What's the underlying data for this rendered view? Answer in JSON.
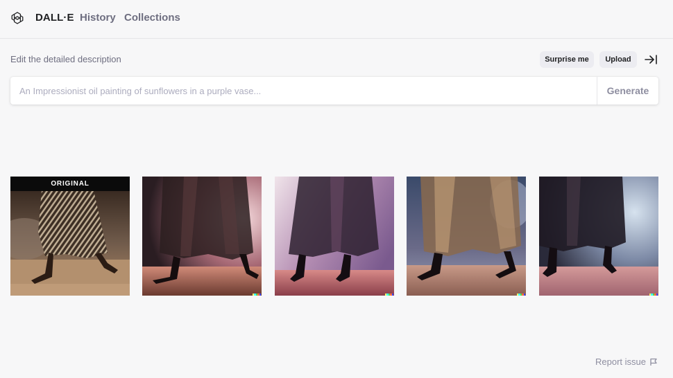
{
  "header": {
    "brand": "DALL·E",
    "nav": [
      "History",
      "Collections"
    ]
  },
  "editor": {
    "label": "Edit the detailed description",
    "surprise_label": "Surprise me",
    "upload_label": "Upload",
    "prompt_placeholder": "An Impressionist oil painting of sunflowers in a purple vase...",
    "prompt_value": "",
    "generate_label": "Generate"
  },
  "gallery": {
    "original_label": "ORIGINAL",
    "tiles": [
      {
        "kind": "original",
        "description": "dancer legs in high heels, sheer patterned skirt, dusty floor"
      },
      {
        "kind": "variation",
        "description": "dancer legs in heels, sheer dark skirt, pink smoke"
      },
      {
        "kind": "variation",
        "description": "dancer legs in heels, flowing skirt, violet smoke"
      },
      {
        "kind": "variation",
        "description": "dancer legs in heels, gold sheer skirt, blue stage"
      },
      {
        "kind": "variation",
        "description": "dancer legs in heels, dark skirt, misty stage"
      }
    ]
  },
  "footer": {
    "report_label": "Report issue"
  },
  "colors": {
    "background": "#f7f7f8",
    "text_primary": "#202123",
    "text_muted": "#6e6e80",
    "pill_bg": "#ececf1",
    "signature": [
      "#ffff66",
      "#42ffff",
      "#51da4c",
      "#ff6e3c",
      "#3c46ff"
    ]
  },
  "icons": {
    "logo": "openai-logo-icon",
    "collapse": "arrow-to-right-icon",
    "flag": "flag-icon"
  }
}
